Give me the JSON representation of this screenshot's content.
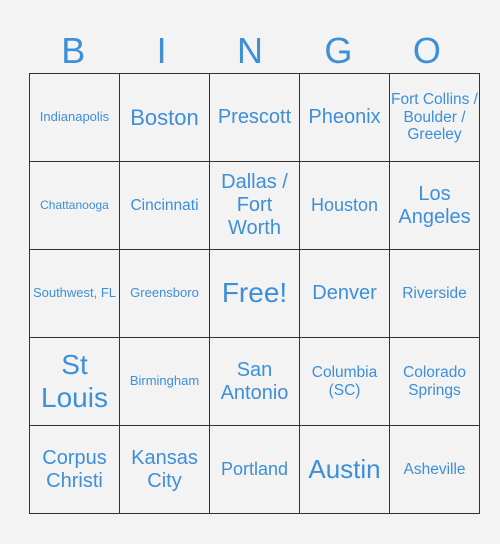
{
  "header": [
    "B",
    "I",
    "N",
    "G",
    "O"
  ],
  "colors": {
    "text": "#3d8fd8",
    "border": "#333333",
    "background": "#f3f3f3"
  },
  "grid": [
    [
      "Indianapolis",
      "Boston",
      "Prescott",
      "Pheonix",
      "Fort Collins / Boulder / Greeley"
    ],
    [
      "Chattanooga",
      "Cincinnati",
      "Dallas / Fort Worth",
      "Houston",
      "Los Angeles"
    ],
    [
      "Southwest, FL",
      "Greensboro",
      "Free!",
      "Denver",
      "Riverside"
    ],
    [
      "St Louis",
      "Birmingham",
      "San Antonio",
      "Columbia (SC)",
      "Colorado Springs"
    ],
    [
      "Corpus Christi",
      "Kansas City",
      "Portland",
      "Austin",
      "Asheville"
    ]
  ]
}
